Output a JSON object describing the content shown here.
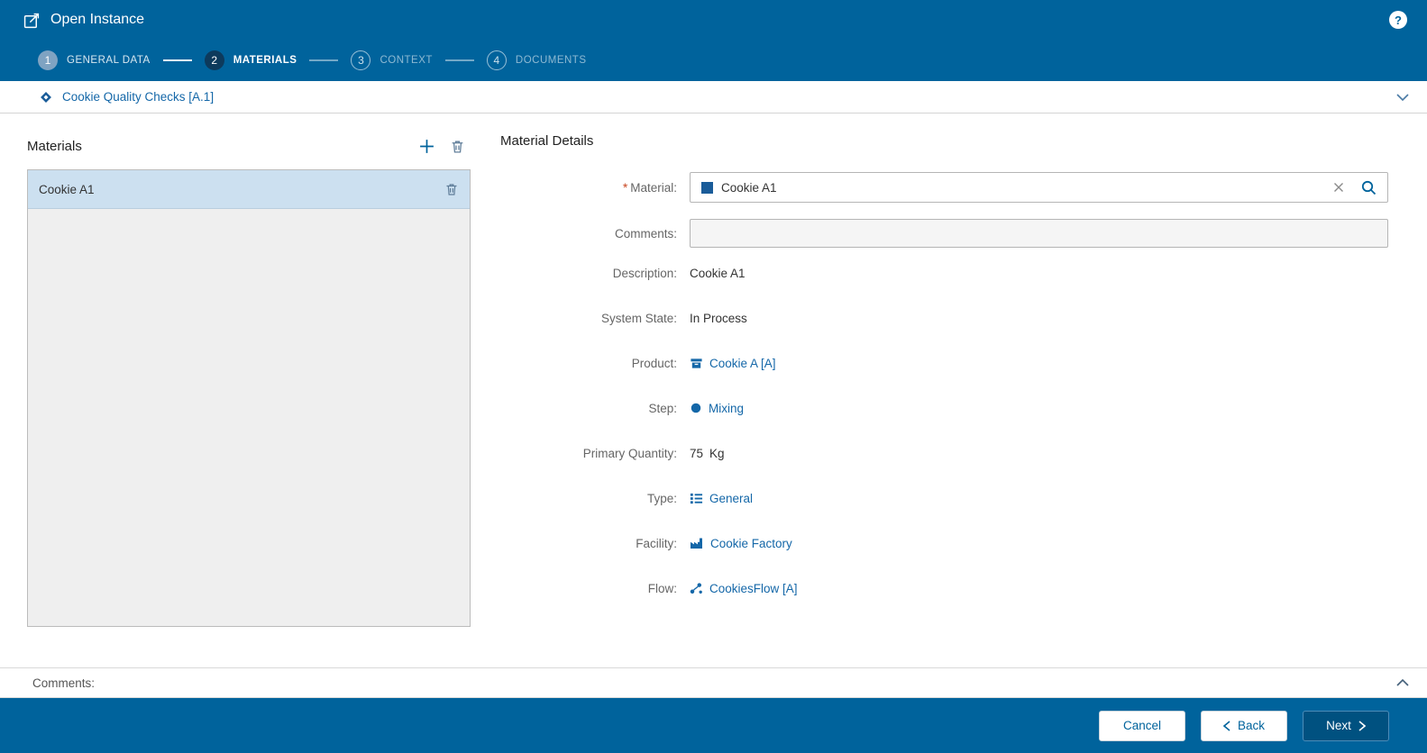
{
  "colors": {
    "header_bg": "#00639C",
    "link_blue": "#1467A8",
    "selected_item_bg": "#CCE0F0",
    "required_marker_color": "#C8441F",
    "primary_button_bg": "#005180",
    "list_panel_bg": "#EFEFEF"
  },
  "header": {
    "title": "Open Instance",
    "help_label": "?"
  },
  "wizard": {
    "steps": [
      {
        "number": "1",
        "label": "GENERAL DATA",
        "state": "done"
      },
      {
        "number": "2",
        "label": "MATERIALS",
        "state": "active"
      },
      {
        "number": "3",
        "label": "CONTEXT",
        "state": "upcoming"
      },
      {
        "number": "4",
        "label": "DOCUMENTS",
        "state": "upcoming"
      }
    ]
  },
  "breadcrumb": {
    "label": "Cookie Quality Checks [A.1]"
  },
  "materials_panel": {
    "title": "Materials",
    "items": [
      {
        "name": "Cookie A1",
        "selected": true
      }
    ]
  },
  "details": {
    "title": "Material Details",
    "material": {
      "required_marker": "*",
      "label": "Material:",
      "value": "Cookie A1"
    },
    "comments": {
      "label": "Comments:",
      "value": ""
    },
    "rows": [
      {
        "label": "Description:",
        "value": "Cookie A1",
        "kind": "text"
      },
      {
        "label": "System State:",
        "value": "In Process",
        "kind": "text"
      },
      {
        "label": "Product:",
        "value": "Cookie A [A]",
        "kind": "link",
        "icon": "product-icon"
      },
      {
        "label": "Step:",
        "value": "Mixing",
        "kind": "link",
        "icon": "step-icon"
      },
      {
        "label": "Primary Quantity:",
        "value": "75",
        "unit": "Kg",
        "kind": "text"
      },
      {
        "label": "Type:",
        "value": "General",
        "kind": "link",
        "icon": "type-icon"
      },
      {
        "label": "Facility:",
        "value": "Cookie Factory",
        "kind": "link",
        "icon": "facility-icon"
      },
      {
        "label": "Flow:",
        "value": "CookiesFlow [A]",
        "kind": "link",
        "icon": "flow-icon"
      }
    ]
  },
  "comments_section": {
    "label": "Comments:"
  },
  "footer": {
    "cancel_label": "Cancel",
    "back_label": "Back",
    "next_label": "Next"
  },
  "icons": {
    "app": "open-instance-icon",
    "help": "help-icon",
    "breadcrumb": "instance-diamond-icon",
    "add": "add-icon",
    "delete": "trash-icon",
    "clear": "clear-x-icon",
    "search": "search-icon",
    "collapse": "chevron-down-icon",
    "expand": "chevron-up-icon"
  }
}
